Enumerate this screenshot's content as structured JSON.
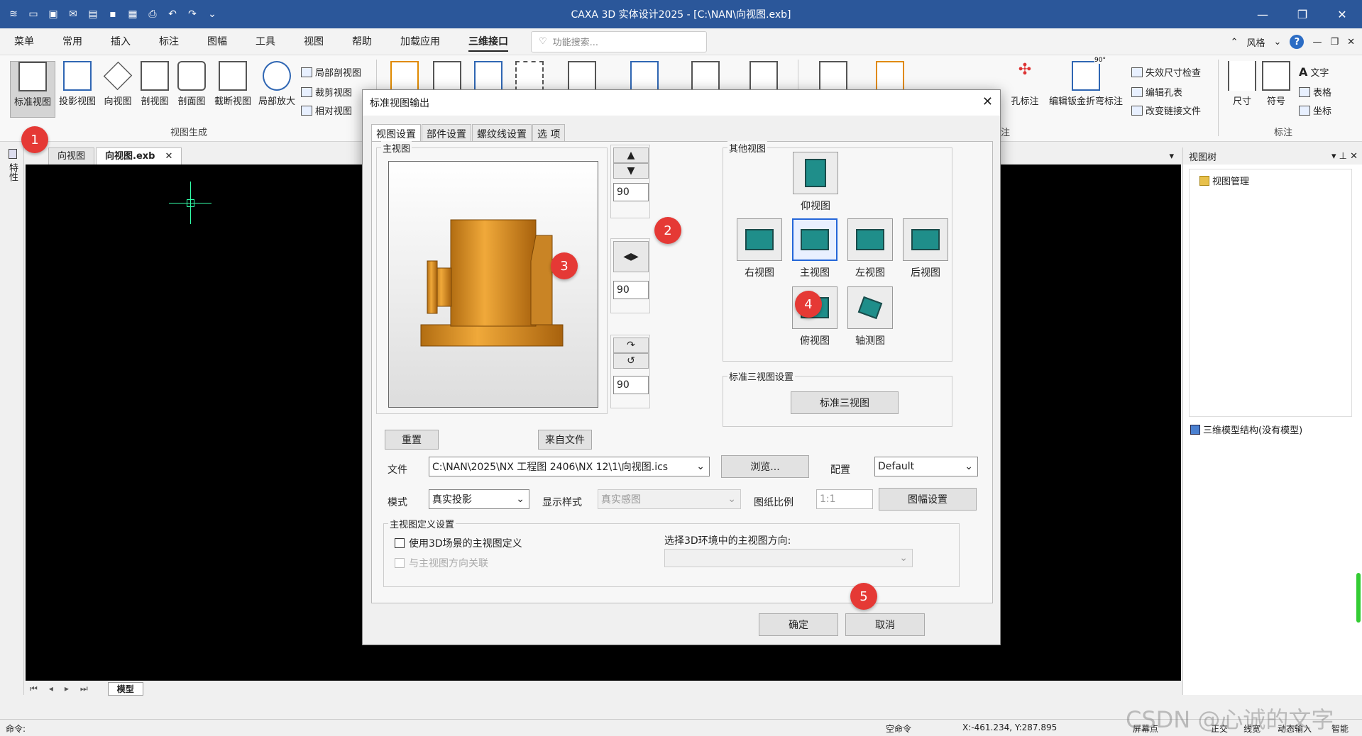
{
  "window": {
    "title": "CAXA 3D 实体设计2025 - [C:\\NAN\\向视图.exb]",
    "title_bg": "#2b579a"
  },
  "menu": {
    "tabs": [
      "菜单",
      "常用",
      "插入",
      "标注",
      "图幅",
      "工具",
      "视图",
      "帮助",
      "加载应用",
      "三维接口"
    ],
    "active": "三维接口",
    "search_placeholder": "功能搜索...",
    "style_label": "风格"
  },
  "ribbon": {
    "view_group": {
      "buttons": [
        "标准视图",
        "投影视图",
        "向视图",
        "剖视图",
        "剖面图",
        "截断视图",
        "局部放大"
      ],
      "small": [
        "局部剖视图",
        "裁剪视图",
        "相对视图"
      ],
      "label": "视图生成"
    },
    "annot_group": {
      "buttons": [
        "孔标注",
        "编辑钣金折弯标注"
      ],
      "small": [
        "失效尺寸检查",
        "编辑孔表",
        "改变链接文件"
      ],
      "label": "注"
    },
    "mark_group": {
      "buttons": [
        "尺寸",
        "符号"
      ],
      "small": [
        "文字",
        "表格",
        "坐标"
      ],
      "label": "标注"
    },
    "angle_label": "90°"
  },
  "left_strip": {
    "label": "特性"
  },
  "doc_tabs": [
    {
      "label": "向视图",
      "active": false
    },
    {
      "label": "向视图.exb",
      "active": true,
      "close": "✕"
    }
  ],
  "model_tab": "模型",
  "right_panel": {
    "title": "视图树",
    "tree_root": "视图管理",
    "model_tree": "三维模型结构(没有模型)"
  },
  "status": {
    "command": "命令:",
    "empty_cmd": "空命令",
    "coords": "X:-461.234, Y:287.895",
    "screen_point": "屏幕点",
    "ortho": "正交",
    "linewidth": "线宽",
    "dynamic_input": "动态输入",
    "smart": "智能"
  },
  "dialog": {
    "title": "标准视图输出",
    "tabs": [
      "视图设置",
      "部件设置",
      "螺纹线设置",
      "选 项"
    ],
    "main_view_label": "主视图",
    "other_views_label": "其他视图",
    "angle1": "90",
    "angle2": "90",
    "angle3": "90",
    "reset_button": "重置",
    "from_file_button": "来自文件",
    "views": [
      "仰视图",
      "右视图",
      "主视图",
      "左视图",
      "后视图",
      "俯视图",
      "轴测图"
    ],
    "std3_label": "标准三视图设置",
    "std3_button": "标准三视图",
    "file_label": "文件",
    "file_path": "C:\\NAN\\2025\\NX 工程图 2406\\NX 12\\1\\向视图.ics",
    "browse_button": "浏览...",
    "config_label": "配置",
    "config_value": "Default",
    "mode_label": "模式",
    "mode_value": "真实投影",
    "display_label": "显示样式",
    "display_value": "真实感图",
    "scale_label": "图纸比例",
    "scale_value": "1:1",
    "sheet_button": "图幅设置",
    "def_group": "主视图定义设置",
    "use3d": "使用3D场景的主视图定义",
    "assoc": "与主视图方向关联",
    "select_dir": "选择3D环境中的主视图方向:",
    "ok_button": "确定",
    "cancel_button": "取消"
  },
  "badges": [
    "1",
    "2",
    "3",
    "4",
    "5"
  ],
  "badge_color": "#e53935",
  "watermark": "CSDN @心诚的文字"
}
